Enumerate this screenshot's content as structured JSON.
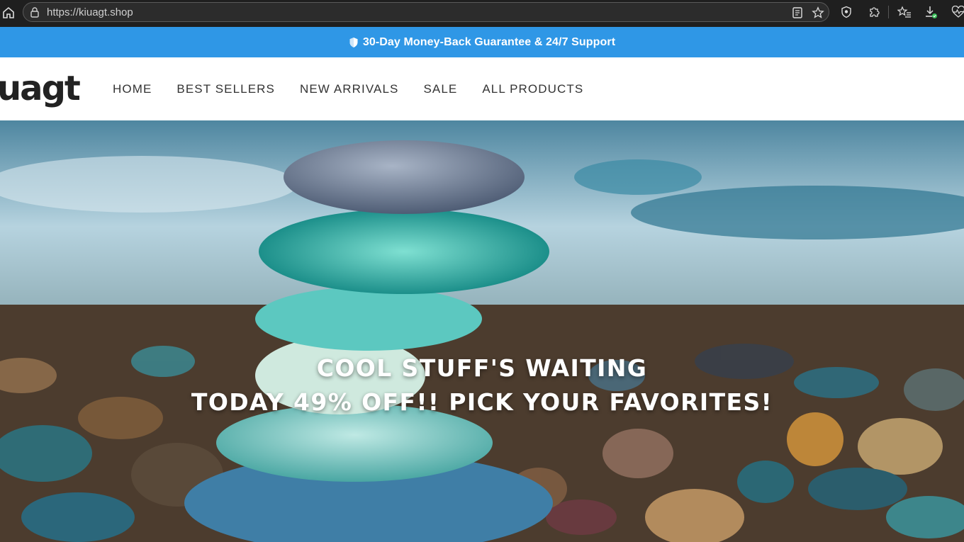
{
  "browser": {
    "url": "https://kiuagt.shop",
    "icons": [
      "home-icon",
      "lock-icon",
      "reader-mode-icon",
      "favorite-star-icon",
      "shield-icon",
      "extensions-icon",
      "favorites-list-icon",
      "downloads-icon",
      "heart-pulse-icon"
    ]
  },
  "announcement": {
    "text": "30-Day Money-Back Guarantee & 24/7 Support",
    "bg_color": "#2f97e6"
  },
  "header": {
    "logo_text": "uagt",
    "nav": [
      "HOME",
      "BEST SELLERS",
      "NEW ARRIVALS",
      "SALE",
      "ALL PRODUCTS"
    ]
  },
  "hero": {
    "line1": "COOL STUFF'S WAITING",
    "line2": "TODAY 49% OFF!! PICK YOUR FAVORITES!"
  }
}
